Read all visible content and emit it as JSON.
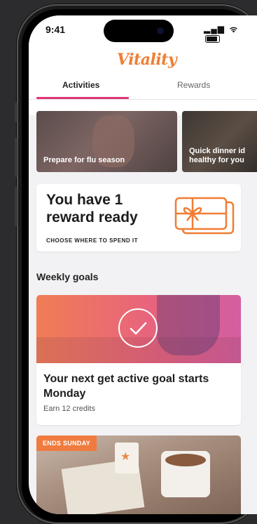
{
  "status_bar": {
    "time": "9:41",
    "signal": "▂▄▆",
    "wifi": "wifi"
  },
  "header": {
    "logo": "Vitality"
  },
  "tabs": [
    {
      "label": "Activities",
      "active": true
    },
    {
      "label": "Rewards",
      "active": false
    }
  ],
  "promos": [
    {
      "label": "Prepare for flu season"
    },
    {
      "label_line1": "Quick dinner id",
      "label_line2": "healthy for you"
    }
  ],
  "reward_card": {
    "title_line1": "You have 1",
    "title_line2": "reward ready",
    "cta": "CHOOSE WHERE TO SPEND IT",
    "icon": "gift-card-icon"
  },
  "weekly_goals": {
    "section_title": "Weekly goals",
    "goal": {
      "title": "Your next get active goal starts Monday",
      "subtitle": "Earn 12 credits",
      "icon": "check-circle-icon"
    }
  },
  "ends_card": {
    "badge": "ENDS SUNDAY"
  },
  "colors": {
    "brand_orange": "#f07d33",
    "tab_indicator": "#e0357a",
    "badge": "#ef7b3f"
  }
}
